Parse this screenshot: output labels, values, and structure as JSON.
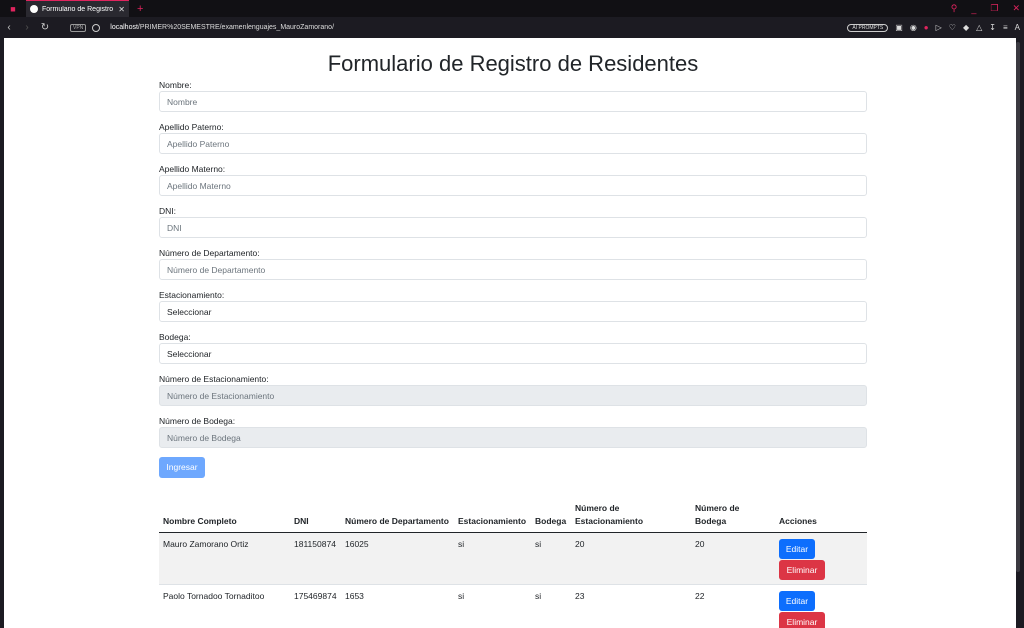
{
  "browser": {
    "tab_title": "Formulario de Registro de",
    "url_host": "localhost",
    "url_path": "/PRIMER%20SEMESTRE/examenlenguajes_MauroZamorano/",
    "vpn_label": "VPN",
    "ai_prompts_label": "AI PROMPTS"
  },
  "page": {
    "title": "Formulario de Registro de Residentes"
  },
  "form": {
    "nombre": {
      "label": "Nombre:",
      "placeholder": "Nombre"
    },
    "apellido_paterno": {
      "label": "Apellido Paterno:",
      "placeholder": "Apellido Paterno"
    },
    "apellido_materno": {
      "label": "Apellido Materno:",
      "placeholder": "Apellido Materno"
    },
    "dni": {
      "label": "DNI:",
      "placeholder": "DNI"
    },
    "num_departamento": {
      "label": "Número de Departamento:",
      "placeholder": "Número de Departamento"
    },
    "estacionamiento": {
      "label": "Estacionamiento:",
      "value": "Seleccionar"
    },
    "bodega": {
      "label": "Bodega:",
      "value": "Seleccionar"
    },
    "num_estacionamiento": {
      "label": "Número de Estacionamiento:",
      "placeholder": "Número de Estacionamiento"
    },
    "num_bodega": {
      "label": "Número de Bodega:",
      "placeholder": "Número de Bodega"
    },
    "submit_label": "Ingresar"
  },
  "table": {
    "headers": {
      "nombre": "Nombre Completo",
      "dni": "DNI",
      "departamento": "Número de Departamento",
      "estacionamiento": "Estacionamiento",
      "bodega": "Bodega",
      "num_estacionamiento": "Número de Estacionamiento",
      "num_bodega": "Número de Bodega",
      "acciones": "Acciones"
    },
    "rows": [
      {
        "nombre": "Mauro Zamorano Ortiz",
        "dni": "181150874",
        "departamento": "16025",
        "estacionamiento": "si",
        "bodega": "si",
        "num_estacionamiento": "20",
        "num_bodega": "20"
      },
      {
        "nombre": "Paolo Tornadoo Tornaditoo",
        "dni": "175469874",
        "departamento": "1653",
        "estacionamiento": "si",
        "bodega": "si",
        "num_estacionamiento": "23",
        "num_bodega": "22"
      }
    ],
    "edit_label": "Editar",
    "delete_label": "Eliminar"
  }
}
